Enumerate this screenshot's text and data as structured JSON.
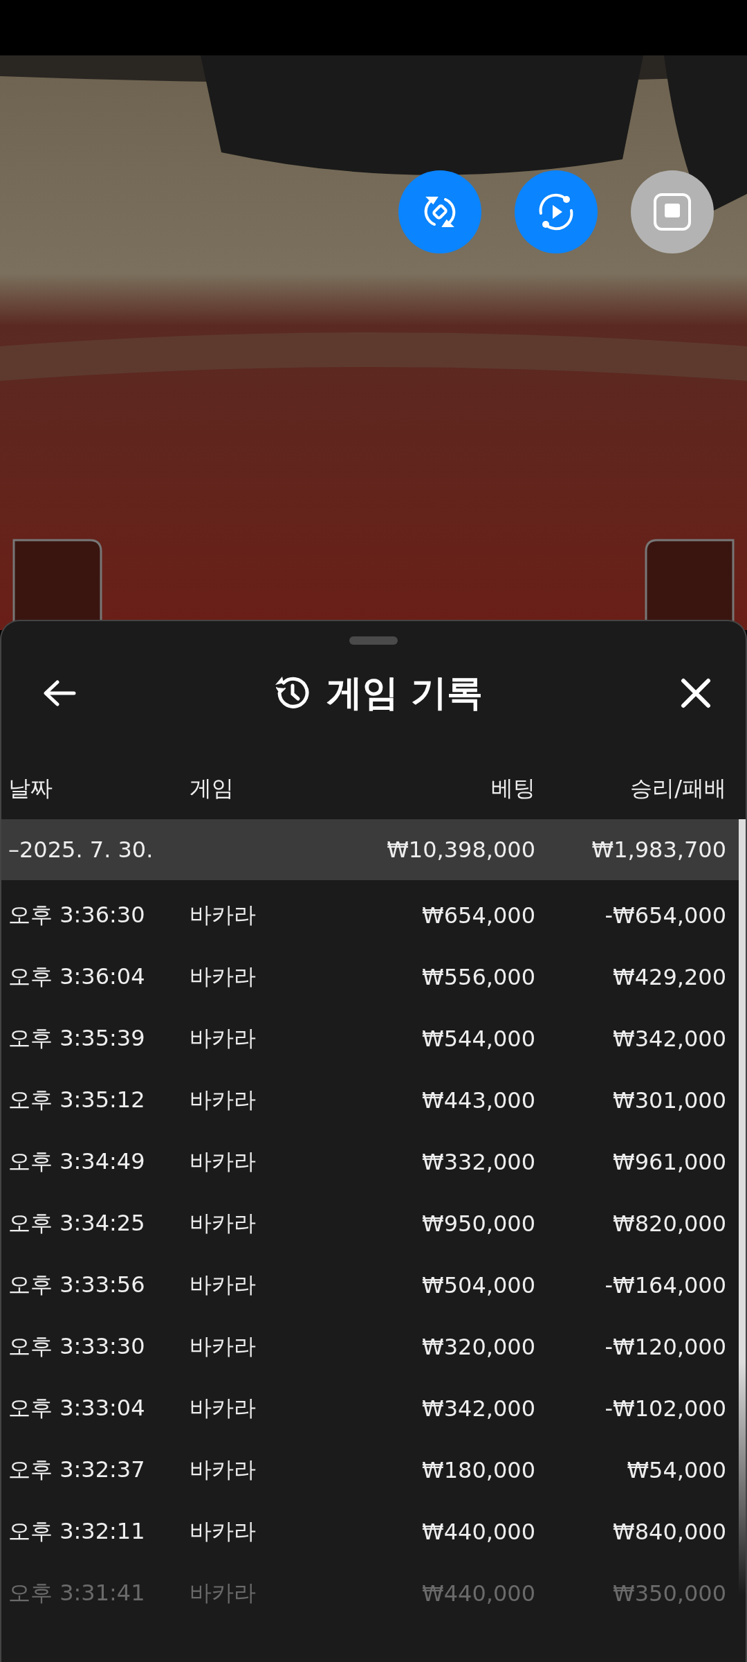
{
  "video_controls": [
    {
      "kind": "rotate"
    },
    {
      "kind": "replay"
    },
    {
      "kind": "stop"
    }
  ],
  "sheet": {
    "title": "게임 기록",
    "columns": [
      "날짜",
      "게임",
      "베팅",
      "승리/패배"
    ],
    "summary": {
      "date": "–2025. 7. 30.",
      "bet": "₩10,398,000",
      "result": "₩1,983,700"
    },
    "rows": [
      {
        "time": "오후 3:36:30",
        "game": "바카라",
        "bet": "₩654,000",
        "result": "-₩654,000",
        "faded": false
      },
      {
        "time": "오후 3:36:04",
        "game": "바카라",
        "bet": "₩556,000",
        "result": "₩429,200",
        "faded": false
      },
      {
        "time": "오후 3:35:39",
        "game": "바카라",
        "bet": "₩544,000",
        "result": "₩342,000",
        "faded": false
      },
      {
        "time": "오후 3:35:12",
        "game": "바카라",
        "bet": "₩443,000",
        "result": "₩301,000",
        "faded": false
      },
      {
        "time": "오후 3:34:49",
        "game": "바카라",
        "bet": "₩332,000",
        "result": "₩961,000",
        "faded": false
      },
      {
        "time": "오후 3:34:25",
        "game": "바카라",
        "bet": "₩950,000",
        "result": "₩820,000",
        "faded": false
      },
      {
        "time": "오후 3:33:56",
        "game": "바카라",
        "bet": "₩504,000",
        "result": "-₩164,000",
        "faded": false
      },
      {
        "time": "오후 3:33:30",
        "game": "바카라",
        "bet": "₩320,000",
        "result": "-₩120,000",
        "faded": false
      },
      {
        "time": "오후 3:33:04",
        "game": "바카라",
        "bet": "₩342,000",
        "result": "-₩102,000",
        "faded": false
      },
      {
        "time": "오후 3:32:37",
        "game": "바카라",
        "bet": "₩180,000",
        "result": "₩54,000",
        "faded": false
      },
      {
        "time": "오후 3:32:11",
        "game": "바카라",
        "bet": "₩440,000",
        "result": "₩840,000",
        "faded": false
      },
      {
        "time": "오후 3:31:41",
        "game": "바카라",
        "bet": "₩440,000",
        "result": "₩350,000",
        "faded": true
      }
    ]
  }
}
